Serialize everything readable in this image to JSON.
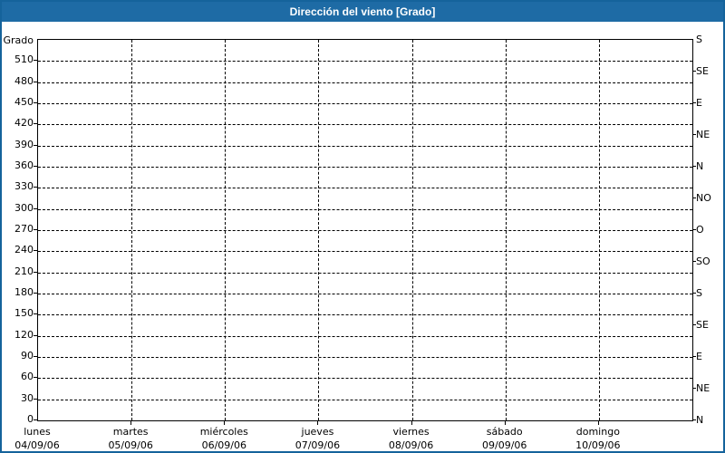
{
  "window": {
    "title": "Dirección del viento [Grado]"
  },
  "colors": {
    "titlebar": "#1E6BA5",
    "frame_border": "#15639B",
    "plot_border": "#000000",
    "gridline": "#000000",
    "plot_bg": "#FFFFFF",
    "page_bg": "#FFFFFF",
    "title_text": "#FFFFFF",
    "label_text": "#000000"
  },
  "chart_data": {
    "type": "line",
    "title": "Dirección del viento [Grado]",
    "grid": true,
    "legend": null,
    "series": [],
    "y_axis_left": {
      "label": "Grado",
      "range": [
        0,
        540
      ],
      "tick_step": 30,
      "ticks": [
        0,
        30,
        60,
        90,
        120,
        150,
        180,
        210,
        240,
        270,
        300,
        330,
        360,
        390,
        420,
        450,
        480,
        510
      ]
    },
    "y_axis_right": {
      "tick_step_degrees": 45,
      "ticks": [
        {
          "value": 0,
          "label": "N"
        },
        {
          "value": 45,
          "label": "NE"
        },
        {
          "value": 90,
          "label": "E"
        },
        {
          "value": 135,
          "label": "SE"
        },
        {
          "value": 180,
          "label": "S"
        },
        {
          "value": 225,
          "label": "SO"
        },
        {
          "value": 270,
          "label": "O"
        },
        {
          "value": 315,
          "label": "NO"
        },
        {
          "value": 360,
          "label": "N"
        },
        {
          "value": 405,
          "label": "NE"
        },
        {
          "value": 450,
          "label": "E"
        },
        {
          "value": 495,
          "label": "SE"
        },
        {
          "value": 540,
          "label": "S"
        }
      ]
    },
    "x_axis": {
      "days": [
        {
          "name": "lunes",
          "date": "04/09/06"
        },
        {
          "name": "martes",
          "date": "05/09/06"
        },
        {
          "name": "miércoles",
          "date": "06/09/06"
        },
        {
          "name": "jueves",
          "date": "07/09/06"
        },
        {
          "name": "viernes",
          "date": "08/09/06"
        },
        {
          "name": "sábado",
          "date": "09/09/06"
        },
        {
          "name": "domingo",
          "date": "10/09/06"
        }
      ]
    }
  }
}
